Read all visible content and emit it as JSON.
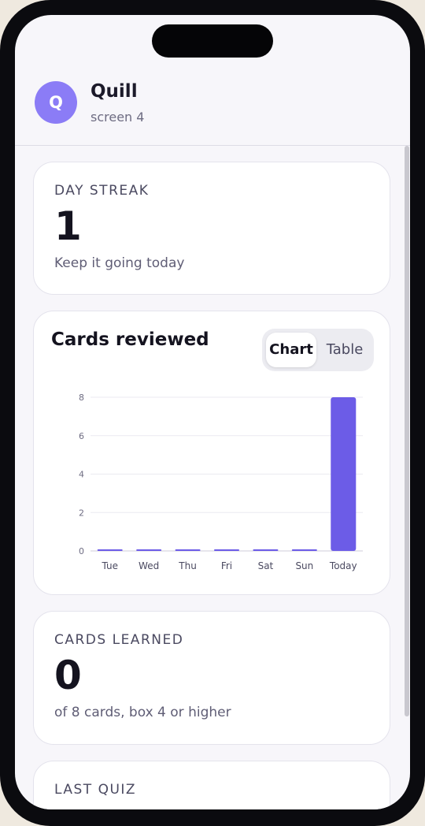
{
  "app": {
    "avatar_letter": "Q",
    "name": "Quill",
    "subtitle": "screen 4"
  },
  "streak": {
    "label": "DAY STREAK",
    "value": "1",
    "caption": "Keep it going today"
  },
  "reviewed": {
    "title": "Cards reviewed",
    "toggle": {
      "chart_label": "Chart",
      "table_label": "Table",
      "selected": "Chart"
    }
  },
  "learned": {
    "label": "CARDS LEARNED",
    "value": "0",
    "caption": "of 8 cards, box 4 or higher"
  },
  "last_quiz": {
    "label": "LAST QUIZ"
  },
  "colors": {
    "accent": "#6c5ce7",
    "avatar": "#8b7cf6"
  },
  "chart_data": {
    "type": "bar",
    "categories": [
      "Tue",
      "Wed",
      "Thu",
      "Fri",
      "Sat",
      "Sun",
      "Today"
    ],
    "values": [
      0,
      0,
      0,
      0,
      0,
      0,
      8
    ],
    "title": "Cards reviewed",
    "xlabel": "",
    "ylabel": "",
    "ylim": [
      0,
      8
    ],
    "yticks": [
      0,
      2,
      4,
      6,
      8
    ],
    "grid": true
  }
}
